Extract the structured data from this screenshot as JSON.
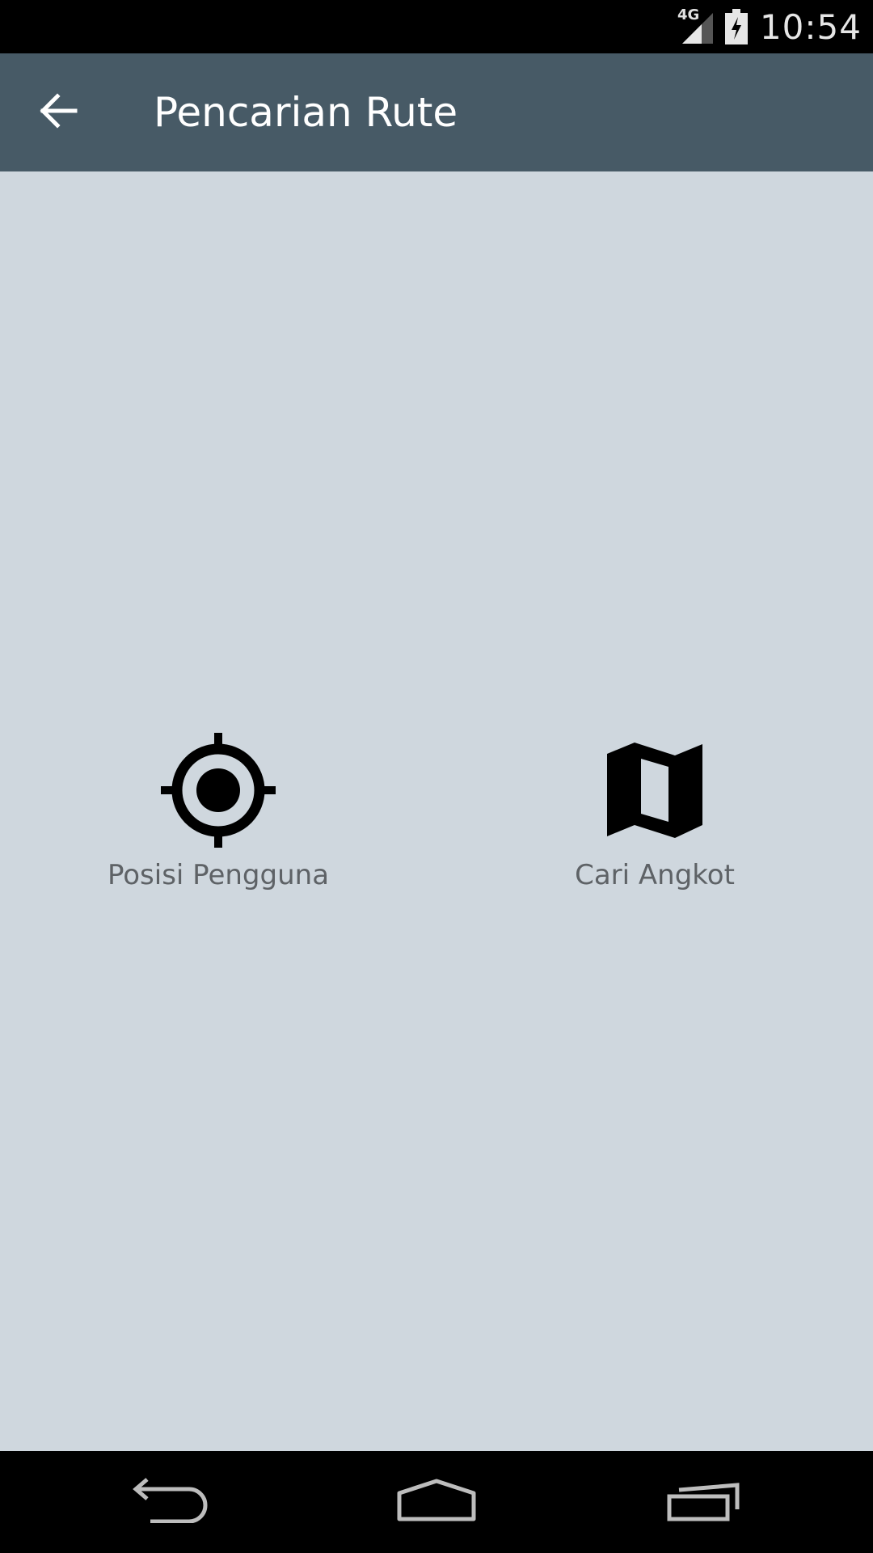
{
  "status_bar": {
    "network": "4G",
    "time": "10:54"
  },
  "app_bar": {
    "title": "Pencarian Rute",
    "back_icon": "arrow-back-icon"
  },
  "options": [
    {
      "label": "Posisi Pengguna",
      "icon": "my-location-icon"
    },
    {
      "label": "Cari Angkot",
      "icon": "map-icon"
    }
  ],
  "nav_bar": {
    "icons": [
      "nav-back-icon",
      "nav-home-icon",
      "nav-recents-icon"
    ]
  },
  "colors": {
    "status_bar": "#000000",
    "app_bar": "#475a66",
    "background": "#cfd7de",
    "label_text": "#5e6266",
    "nav_bar": "#000000"
  }
}
